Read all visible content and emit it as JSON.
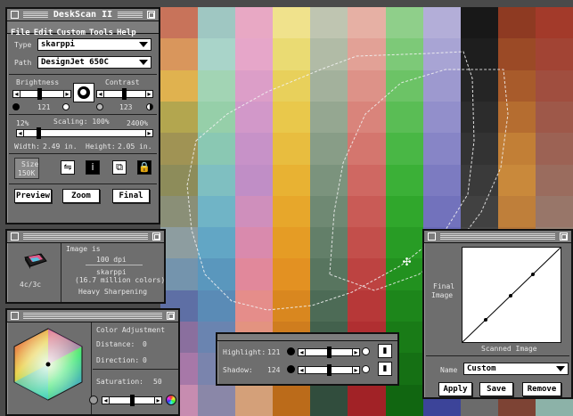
{
  "main_window": {
    "title": "DeskScan II",
    "menu": [
      "File",
      "Edit",
      "Custom",
      "Tools",
      "Help"
    ],
    "type_label": "Type",
    "type_value": "skarppi",
    "path_label": "Path",
    "path_value": "DesignJet 650C",
    "brightness_label": "Brightness",
    "brightness_value": "121",
    "contrast_label": "Contrast",
    "contrast_value": "123",
    "scaling_label": "Scaling: 100%",
    "scaling_min": "12%",
    "scaling_max": "2400%",
    "width_label": "Width:",
    "width_value": "2.49 in.",
    "height_label": "Height:",
    "height_value": "2.05 in.",
    "size_label": "Size",
    "size_value": "150K",
    "buttons": {
      "preview": "Preview",
      "zoom": "Zoom",
      "final": "Final"
    },
    "tool_icons": [
      "mirror-icon",
      "info-icon",
      "multi-image-icon",
      "lock-icon"
    ]
  },
  "image_info": {
    "heading": "Image is",
    "dpi": "100 dpi",
    "name": "skarppi",
    "colors": "(16.7 million colors)",
    "sharpening": "Heavy Sharpening",
    "icon_label": "4c/3c"
  },
  "color_adjustment": {
    "title": "Color Adjustment",
    "distance_label": "Distance:",
    "distance_value": "0",
    "direction_label": "Direction:",
    "direction_value": "0",
    "saturation_label": "Saturation:",
    "saturation_value": "50"
  },
  "levels": {
    "highlight_label": "Highlight:",
    "highlight_value": "121",
    "shadow_label": "Shadow:",
    "shadow_value": "124"
  },
  "curve": {
    "y_label_line1": "Final",
    "y_label_line2": "Image",
    "x_label": "Scanned Image",
    "name_label": "Name",
    "name_value": "Custom",
    "buttons": {
      "apply": "Apply",
      "save": "Save",
      "remove": "Remove"
    }
  },
  "sliders": {
    "brightness": 0.45,
    "contrast": 0.48,
    "scaling": 0.1,
    "highlight": 0.5,
    "shadow": 0.52,
    "saturation": 0.5
  },
  "preview_swatches": {
    "columns": [
      [
        "#c8735a",
        "#d9965c",
        "#e0b24f",
        "#b3a64f",
        "#a09354",
        "#8d8c5a",
        "#8a8f77",
        "#8d9da0",
        "#7494ad",
        "#5e6fa5",
        "#8a6f9e",
        "#a778a8",
        "#c78cb0"
      ],
      [
        "#9fc7c2",
        "#a9d4c9",
        "#a2d4b4",
        "#96cfa9",
        "#8ac8b3",
        "#7fbfc1",
        "#70b4c6",
        "#62a6c5",
        "#5a97bd",
        "#5a8bb6",
        "#6a84b0",
        "#7a84ad",
        "#8a87a8"
      ],
      [
        "#e8a8c4",
        "#e6a6c9",
        "#dc9ec8",
        "#d298c9",
        "#c792c8",
        "#c08ec6",
        "#cf8fbc",
        "#d98aad",
        "#e1889b",
        "#e58d8a",
        "#e39380",
        "#dc9a7b",
        "#d4a079"
      ],
      [
        "#f0e28c",
        "#eadb73",
        "#e8d05b",
        "#e9c84b",
        "#e8bd3f",
        "#e8b233",
        "#e7a72b",
        "#e59c25",
        "#e39122",
        "#d9871f",
        "#cf7d1e",
        "#c5741c",
        "#bb6b1a"
      ],
      [
        "#bfc5b1",
        "#b1bba6",
        "#a3b19c",
        "#95a791",
        "#889d87",
        "#7b937d",
        "#6f8973",
        "#637f69",
        "#58755f",
        "#4d6b56",
        "#43614d",
        "#3a5745",
        "#314d3d"
      ],
      [
        "#e6b0a4",
        "#e2a196",
        "#dd9288",
        "#d9847b",
        "#d4766e",
        "#cf6862",
        "#c95b56",
        "#c34f4b",
        "#bd4341",
        "#b73838",
        "#b02f31",
        "#a9282b",
        "#a12226"
      ],
      [
        "#8fcf8a",
        "#7dc978",
        "#6cc366",
        "#5abd55",
        "#49b745",
        "#3bb037",
        "#30a72c",
        "#289c25",
        "#22911f",
        "#1d861b",
        "#197b17",
        "#157014",
        "#116611"
      ],
      [
        "#b3aed8",
        "#a8a4d4",
        "#9d99cf",
        "#928fcb",
        "#8785c6",
        "#7c7bc1",
        "#7272bc",
        "#6869b7",
        "#5e61b1",
        "#5559ab",
        "#4c52a5",
        "#444b9f",
        "#3c4499"
      ],
      [
        "#181818",
        "#1e1e1e",
        "#252525",
        "#2c2c2c",
        "#333333",
        "#3a3a3a",
        "#414141",
        "#484848",
        "#4f4f4f",
        "#565656",
        "#5d5d5d",
        "#646464",
        "#6b6b6b"
      ],
      [
        "#8e3a22",
        "#9b4a26",
        "#a85b2b",
        "#b56d30",
        "#c27f36",
        "#c9893b",
        "#bf7f3a",
        "#b47539",
        "#a96b38",
        "#9e6137",
        "#935736",
        "#884d35",
        "#7d4334"
      ],
      [
        "#a33a2a",
        "#a24434",
        "#a04e3f",
        "#9e5849",
        "#9c6254",
        "#9a6c5e",
        "#987669",
        "#968073",
        "#948a7e",
        "#929488",
        "#909e93",
        "#8ea89d",
        "#8cb2a8"
      ]
    ]
  }
}
